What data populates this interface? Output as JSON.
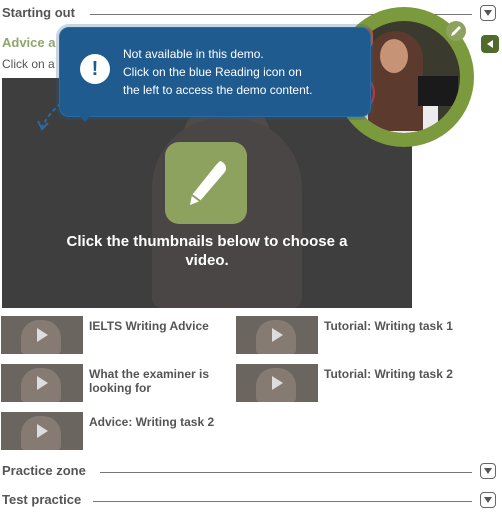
{
  "sections": {
    "starting_out": "Starting out",
    "practice_zone": "Practice zone",
    "test_practice": "Test practice"
  },
  "advice": {
    "title_partial": "Advice a",
    "instruction_partial": "Click on a"
  },
  "video": {
    "caption": "Click the thumbnails below to choose a video."
  },
  "thumbnails": [
    {
      "label": "IELTS Writing Advice"
    },
    {
      "label": "Tutorial: Writing task 1"
    },
    {
      "label": "What the examiner is looking for"
    },
    {
      "label": "Tutorial: Writing task 2"
    },
    {
      "label": "Advice: Writing task 2"
    }
  ],
  "callout": {
    "line1": "Not available in this demo.",
    "line2": "Click on the blue Reading icon on",
    "line3": "the left to access the demo content."
  },
  "colors": {
    "accent_green": "#8ea25f",
    "callout_blue": "#1f5b8e",
    "ring_red": "#c0394b"
  },
  "icons": {
    "info": "info-icon",
    "pencil": "pencil-icon",
    "chevron": "chevron-down-icon",
    "play": "play-icon",
    "reading": "reading-icon",
    "listening": "listening-icon",
    "speaking": "speaking-icon"
  }
}
